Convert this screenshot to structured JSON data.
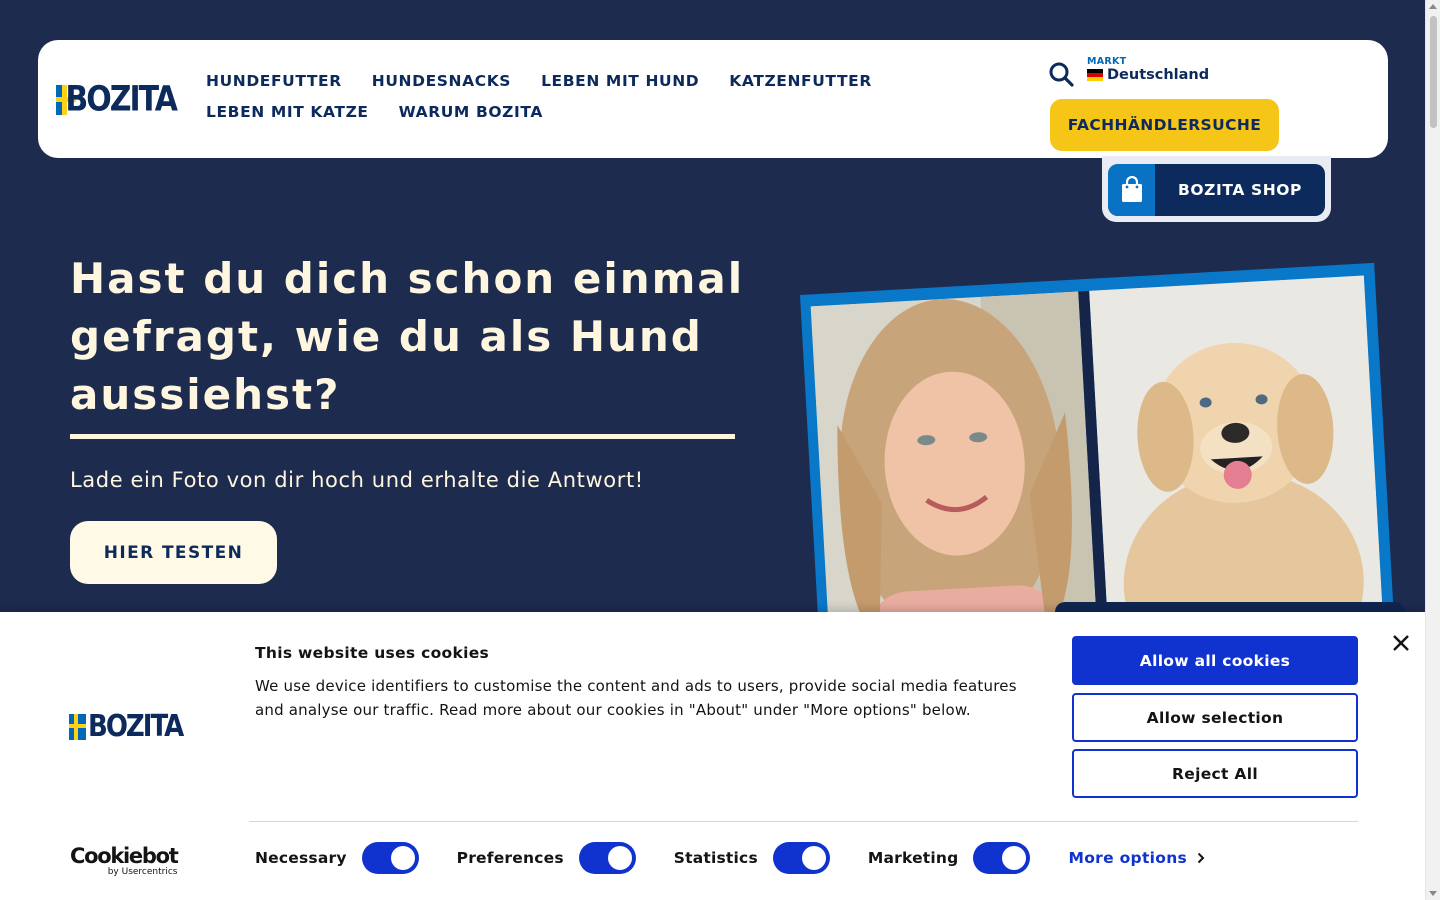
{
  "header": {
    "logo_text": "BOZITA",
    "nav": [
      "HUNDEFUTTER",
      "HUNDESNACKS",
      "LEBEN MIT HUND",
      "KATZENFUTTER",
      "LEBEN MIT KATZE",
      "WARUM BOZITA"
    ],
    "market_label": "MARKT",
    "market_value": "Deutschland",
    "dealer_button": "FACHHÄNDLERSUCHE",
    "shop_button": "BOZITA SHOP"
  },
  "hero": {
    "title": "Hast du dich schon einmal gefragt, wie du als Hund aussiehst?",
    "subtitle": "Lade ein Foto von dir hoch und erhalte die Antwort!",
    "cta": "HIER TESTEN"
  },
  "cookie_banner": {
    "logo_text": "BOZITA",
    "title": "This website uses cookies",
    "text": "We use device identifiers to customise the content and ads to users, provide social media features and analyse our traffic. Read more about our cookies in \"About\" under \"More options\" below.",
    "allow_all": "Allow all cookies",
    "allow_selection": "Allow selection",
    "reject_all": "Reject All",
    "toggles": [
      {
        "label": "Necessary",
        "checked": true
      },
      {
        "label": "Preferences",
        "checked": true
      },
      {
        "label": "Statistics",
        "checked": true
      },
      {
        "label": "Marketing",
        "checked": true
      }
    ],
    "more_options": "More options",
    "provider_name": "Cookiebot",
    "provider_sub": "by Usercentrics"
  },
  "colors": {
    "page_bg": "#1d2b4f",
    "brand_navy": "#0d2a5c",
    "brand_blue": "#0068b4",
    "brand_yellow": "#f5c518",
    "cookie_accent": "#1032cf",
    "hero_text": "#fff6e0"
  },
  "icons": [
    "search-icon",
    "germany-flag-icon",
    "shopping-bag-icon",
    "close-icon",
    "chevron-right-icon"
  ]
}
